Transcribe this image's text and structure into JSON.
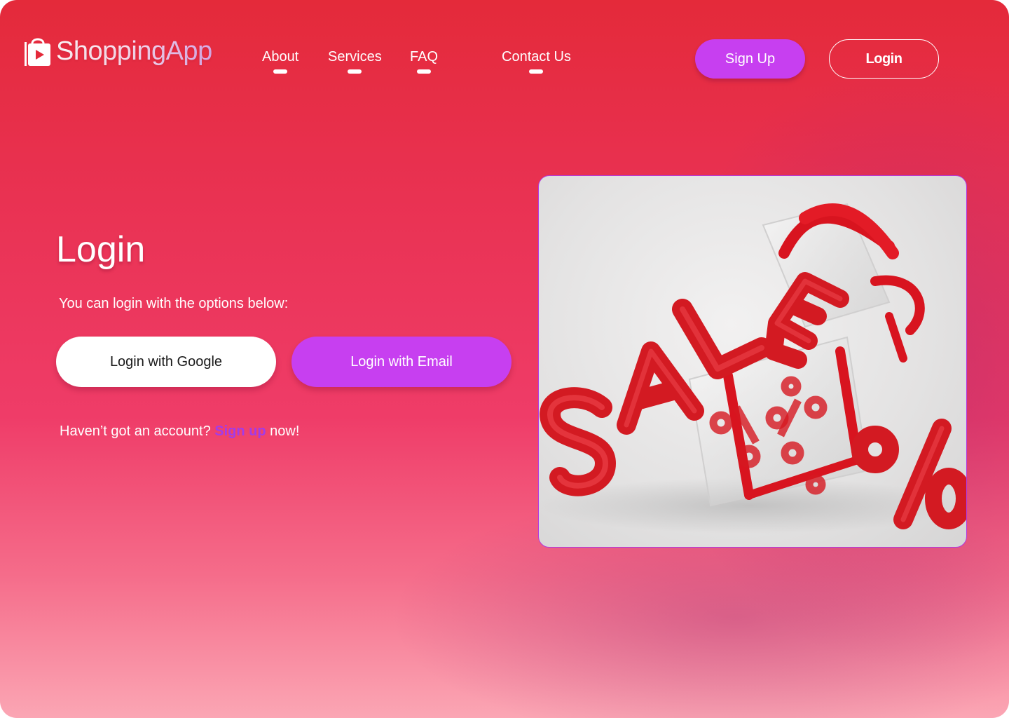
{
  "header": {
    "logo_text": "ShoppingApp",
    "logo_icon": "shopping-bag-play-icon",
    "nav": [
      {
        "label": "About"
      },
      {
        "label": "Services"
      },
      {
        "label": "FAQ"
      },
      {
        "label": "Contact Us"
      }
    ],
    "signup_label": "Sign Up",
    "login_label": "Login"
  },
  "main": {
    "title": "Login",
    "subtitle": "You can login with the options below:",
    "google_button_label": "Login with Google",
    "email_button_label": "Login with Email",
    "signup_prompt": {
      "before": "Haven’t got an account?",
      "link": "Sign up",
      "after": "now!"
    }
  },
  "hero_image": {
    "balloon_text": "SALE",
    "balloon_symbol": "%"
  },
  "colors": {
    "accent_purple": "#c73ff0",
    "background_top": "#e42a3a",
    "background_bottom": "#fba6b4",
    "link_purple": "#a33be8"
  }
}
